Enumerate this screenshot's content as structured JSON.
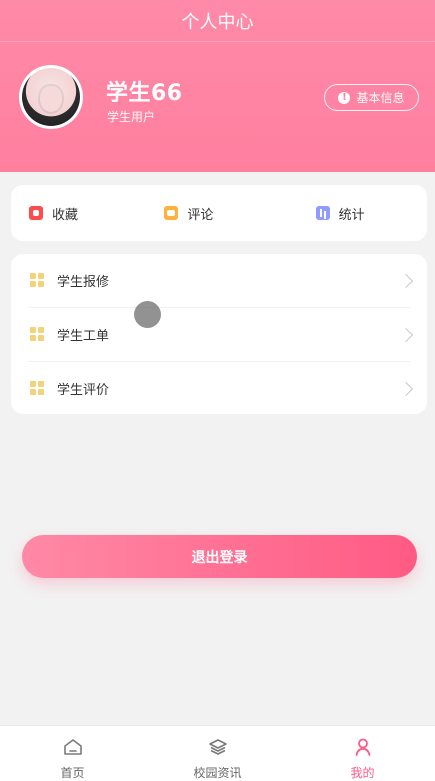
{
  "topbar": {
    "title": "个人中心"
  },
  "profile": {
    "name": "学生66",
    "role": "学生用户",
    "basic_info_button": "基本信息",
    "basic_info_icon": "info-icon",
    "header_colors": [
      "#ff8aa8",
      "#ff7f9f"
    ]
  },
  "quick_actions": [
    {
      "label": "收藏",
      "icon": "favorite-icon",
      "color": "#ff4b4b"
    },
    {
      "label": "评论",
      "icon": "comment-icon",
      "color": "#ffb13d"
    },
    {
      "label": "统计",
      "icon": "stats-icon",
      "color": "#8f9bff"
    }
  ],
  "menu": [
    {
      "label": "学生报修",
      "icon": "grid-icon"
    },
    {
      "label": "学生工单",
      "icon": "grid-icon"
    },
    {
      "label": "学生评价",
      "icon": "grid-icon"
    }
  ],
  "logout": {
    "label": "退出登录",
    "colors": [
      "#ff89a6",
      "#ff5a84"
    ]
  },
  "tabbar": [
    {
      "label": "首页",
      "icon": "home-icon",
      "active": false
    },
    {
      "label": "校园资讯",
      "icon": "layers-icon",
      "active": false
    },
    {
      "label": "我的",
      "icon": "user-icon",
      "active": true
    }
  ]
}
